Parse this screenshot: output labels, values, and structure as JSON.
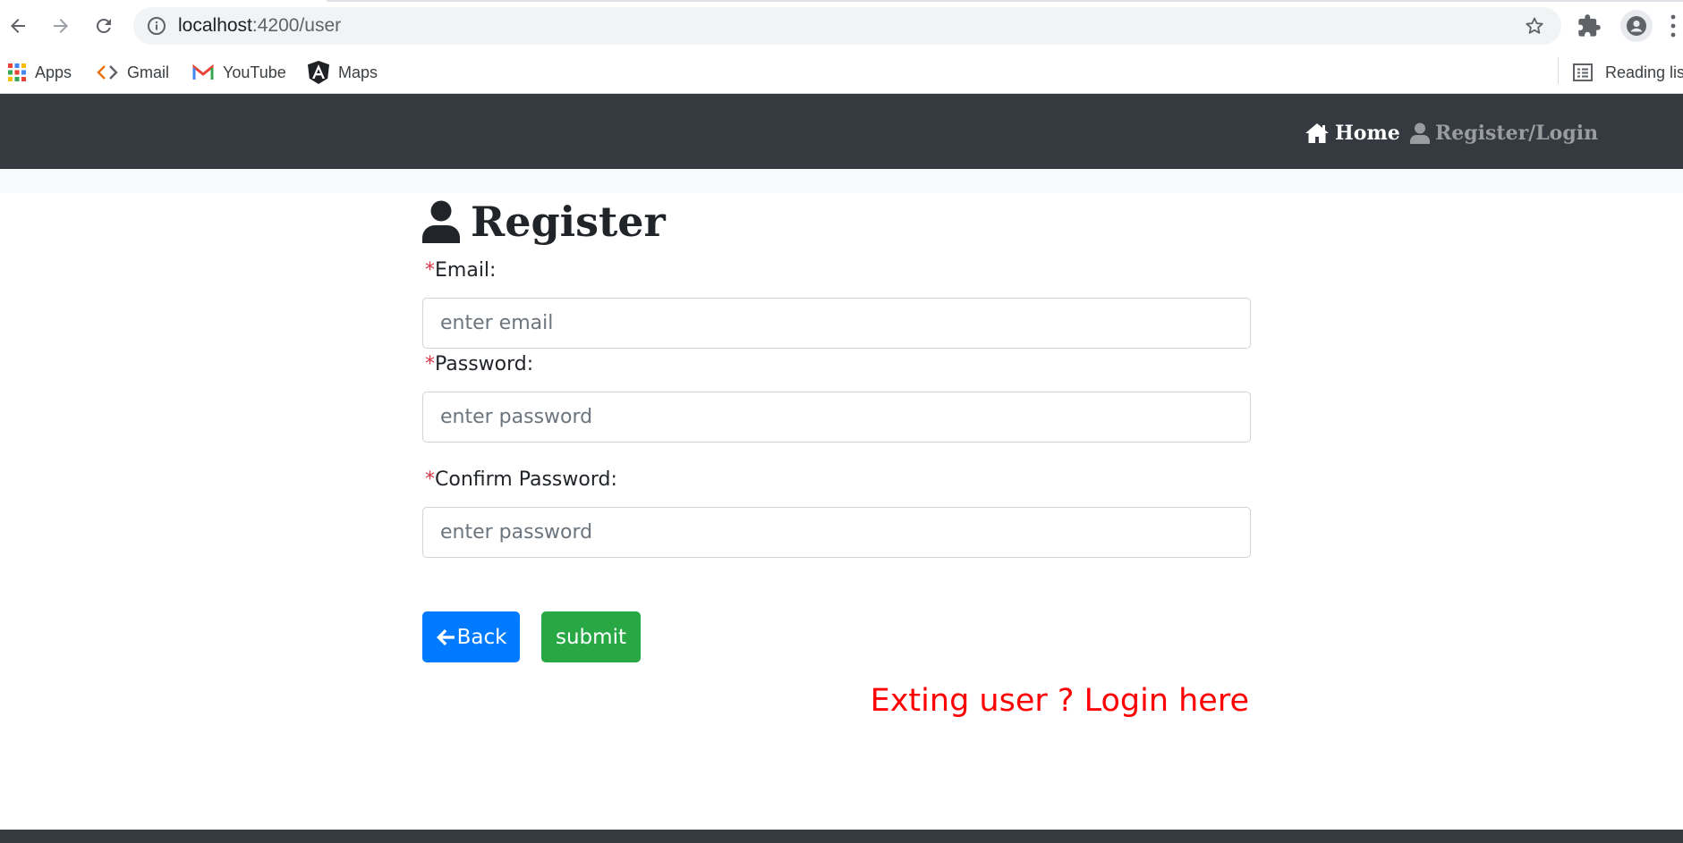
{
  "browser": {
    "url_host": "localhost",
    "url_path": ":4200/user",
    "bookmarks": [
      {
        "label": "Apps",
        "icon": "apps-grid-icon"
      },
      {
        "label": "Gmail",
        "icon": "code-brackets-icon"
      },
      {
        "label": "YouTube",
        "icon": "gmail-m-icon"
      },
      {
        "label": "Maps",
        "icon": "angular-icon"
      }
    ],
    "reading_list": "Reading list"
  },
  "navbar": {
    "home_label": "Home",
    "register_label": "Register/Login"
  },
  "form": {
    "title": "Register",
    "required_mark": "*",
    "email_label": "Email:",
    "email_placeholder": "enter email",
    "password_label": "Password:",
    "password_placeholder": "enter password",
    "confirm_label": "Confirm Password:",
    "confirm_placeholder": "enter password",
    "back_label": "Back",
    "submit_label": "submit",
    "login_link": "Exting user ? Login here"
  },
  "colors": {
    "navbar_bg": "#343a40",
    "back_button": "#007bff",
    "submit_button": "#28a745",
    "required": "#dc3545",
    "login_link": "#ff0000"
  }
}
